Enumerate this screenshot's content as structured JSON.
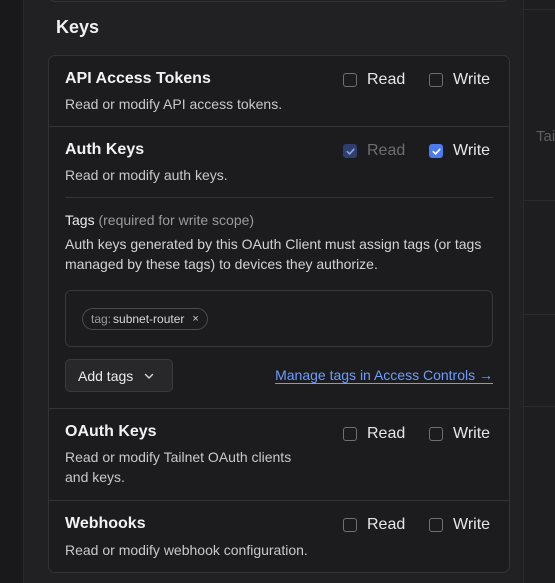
{
  "background": {
    "partial_text": "Tai"
  },
  "section": {
    "title": "Keys"
  },
  "labels": {
    "read": "Read",
    "write": "Write"
  },
  "scopes": [
    {
      "title": "API Access Tokens",
      "description": "Read or modify API access tokens.",
      "read": false,
      "write": false
    },
    {
      "title": "Auth Keys",
      "description": "Read or modify auth keys.",
      "read": true,
      "read_disabled": true,
      "write": true
    },
    {
      "title": "OAuth Keys",
      "description": "Read or modify Tailnet OAuth clients and keys.",
      "read": false,
      "write": false
    },
    {
      "title": "Webhooks",
      "description": "Read or modify webhook configuration.",
      "read": false,
      "write": false
    }
  ],
  "tags": {
    "label": "Tags",
    "hint": "(required for write scope)",
    "description": "Auth keys generated by this OAuth Client must assign tags (or tags managed by these tags) to devices they authorize.",
    "chips": [
      {
        "prefix": "tag:",
        "value": "subnet-router",
        "close": "×"
      }
    ],
    "add_button": "Add tags",
    "manage_link": "Manage tags in Access Controls →"
  },
  "colors": {
    "accent": "#4c7bf0",
    "link": "#6d9cff",
    "surface": "#1c1c1e"
  }
}
